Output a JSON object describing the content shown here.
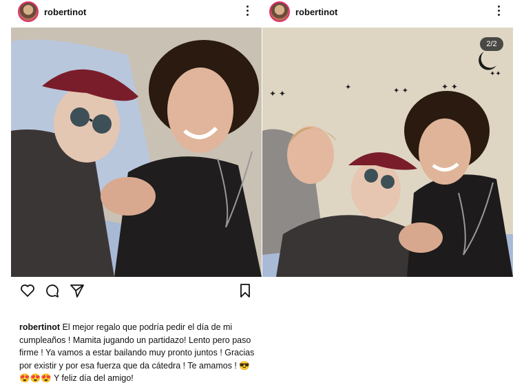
{
  "posts": [
    {
      "username": "robertinot",
      "photo_alt": "Two people smiling in a hospital bed, holding hands"
    },
    {
      "username": "robertinot",
      "photo_alt": "Three people smiling together, one lying in bed"
    }
  ],
  "carousel": {
    "counter": "2/2"
  },
  "caption": {
    "username": "robertinot",
    "text": "El mejor regalo que podría pedir el día de mi cumpleaños ! Mamita jugando un partidazo!  Lento pero paso firme ! Ya vamos  a estar bailando muy pronto juntos !  Gracias por existir y por esa fuerza que da cátedra ! Te amamos ! 😎😍😍😍 Y feliz día del amigo!"
  },
  "icons": [
    "heart-icon",
    "comment-icon",
    "share-icon",
    "bookmark-icon",
    "more-options-icon"
  ],
  "colors": {
    "story_ring": "#e1306c",
    "text": "#111111",
    "background": "#ffffff"
  }
}
